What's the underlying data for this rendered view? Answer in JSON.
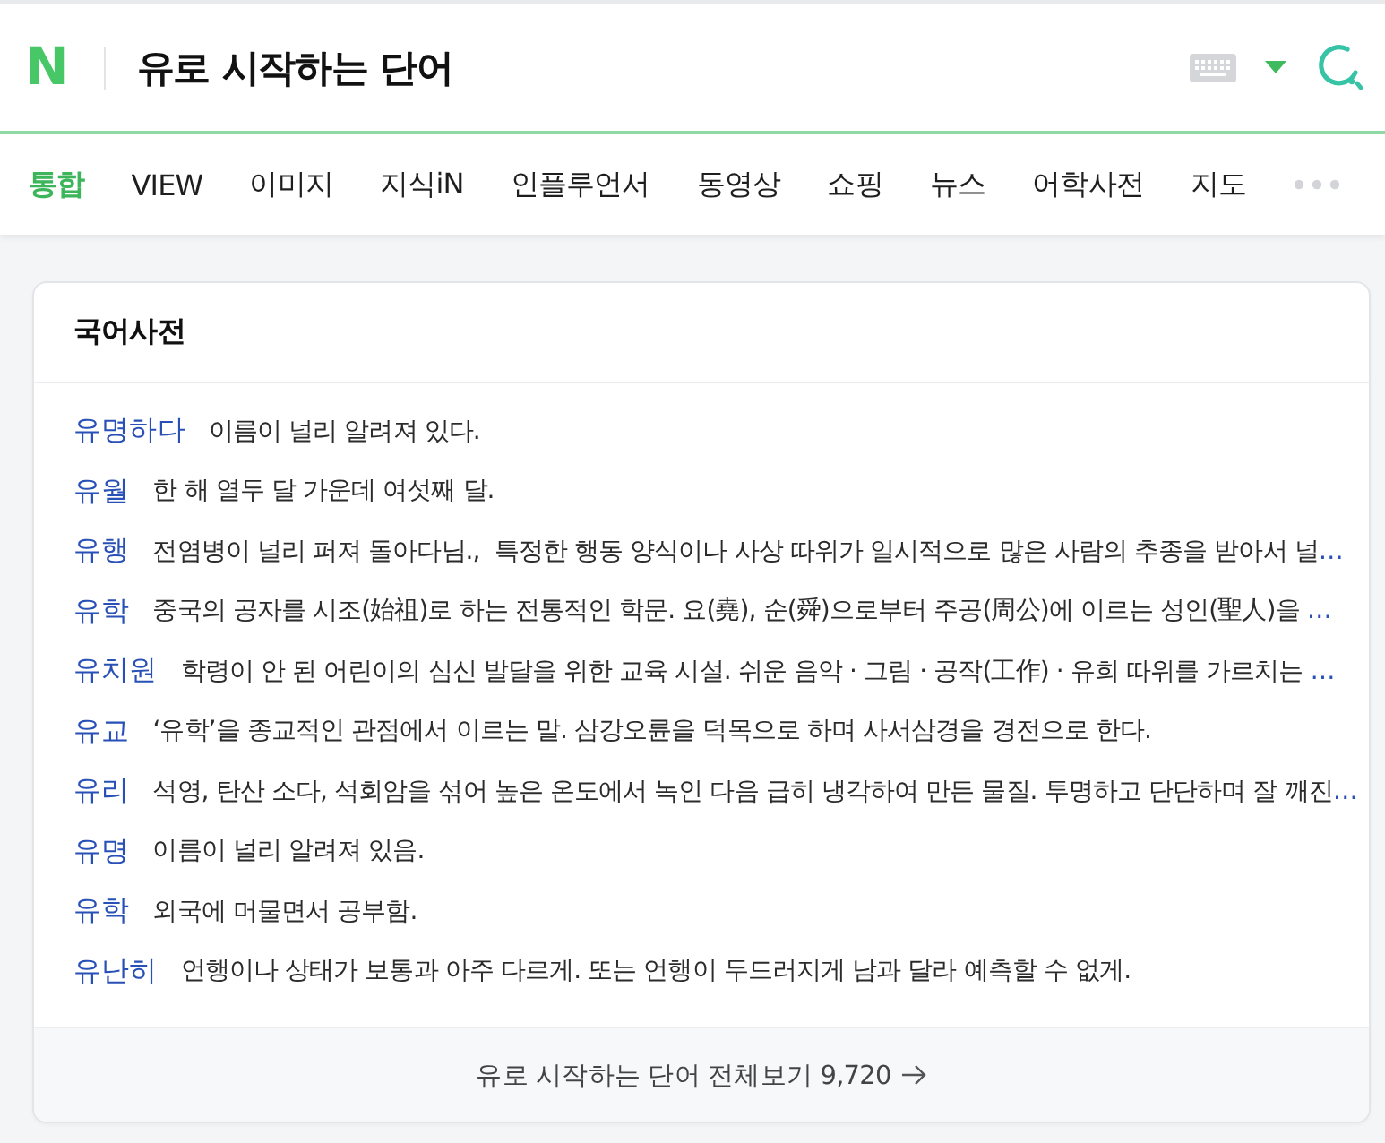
{
  "search_bar": {
    "logo": "N",
    "query": "유로 시작하는 단어"
  },
  "tabs": [
    {
      "label": "통합",
      "selected": true
    },
    {
      "label": "VIEW",
      "selected": false
    },
    {
      "label": "이미지",
      "selected": false
    },
    {
      "label": "지식iN",
      "selected": false
    },
    {
      "label": "인플루언서",
      "selected": false
    },
    {
      "label": "동영상",
      "selected": false
    },
    {
      "label": "쇼핑",
      "selected": false
    },
    {
      "label": "뉴스",
      "selected": false
    },
    {
      "label": "어학사전",
      "selected": false
    },
    {
      "label": "지도",
      "selected": false
    }
  ],
  "dictionary_card": {
    "title": "국어사전",
    "entries": [
      {
        "word": "유명하다",
        "definition": "이름이 널리 알려져 있다."
      },
      {
        "word": "유월",
        "definition": "한 해 열두 달 가운데 여섯째 달."
      },
      {
        "word": "유행",
        "definition": "전염병이 널리 퍼져 돌아다님.,  특정한 행동 양식이나 사상 따위가 일시적으로 많은 사람의 추종을 받아서 널",
        "more": "…"
      },
      {
        "word": "유학",
        "definition": "중국의 공자를 시조(始祖)로 하는 전통적인 학문. 요(堯), 순(舜)으로부터 주공(周公)에 이르는 성인(聖人)을 ",
        "more": "…"
      },
      {
        "word": "유치원",
        "definition": "학령이 안 된 어린이의 심신 발달을 위한 교육 시설. 쉬운 음악 · 그림 · 공작(工作) · 유희 따위를 가르치는 ",
        "more": "…"
      },
      {
        "word": "유교",
        "definition": "‘유학’을 종교적인 관점에서 이르는 말. 삼강오륜을 덕목으로 하며 사서삼경을 경전으로 한다."
      },
      {
        "word": "유리",
        "definition": "석영, 탄산 소다, 석회암을 섞어 높은 온도에서 녹인 다음 급히 냉각하여 만든 물질. 투명하고 단단하며 잘 깨진",
        "more": "…"
      },
      {
        "word": "유명",
        "definition": "이름이 널리 알려져 있음."
      },
      {
        "word": "유학",
        "definition": "외국에 머물면서 공부함."
      },
      {
        "word": "유난히",
        "definition": "언행이나 상태가 보통과 아주 다르게. 또는 언행이 두드러지게 남과 달라 예측할 수 없게."
      }
    ],
    "footer": {
      "label": "유로 시작하는 단어 전체보기 9,720"
    }
  }
}
